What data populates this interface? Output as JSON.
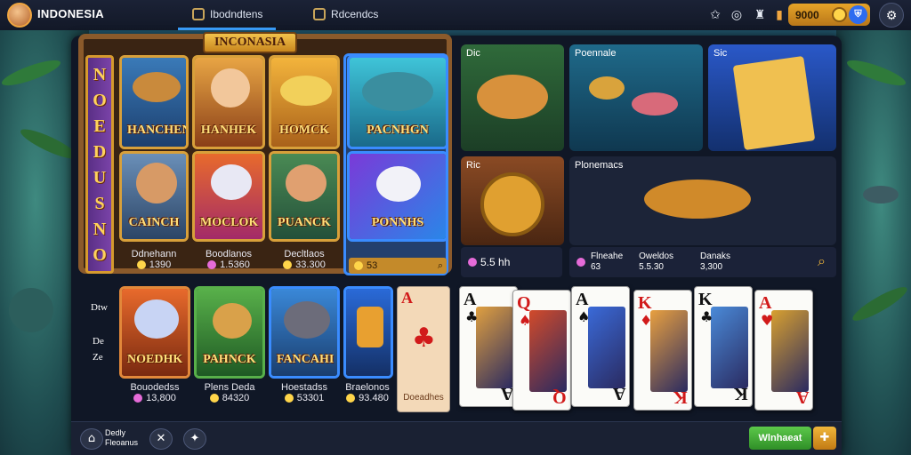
{
  "header": {
    "brand": "INDONESIA",
    "nav": [
      {
        "label": "Ibodndtens"
      },
      {
        "label": "Rdcendcs"
      }
    ],
    "balance": "9000",
    "icons": [
      "star-icon",
      "globe-icon",
      "trophy-icon",
      "coin-icon",
      "shield-icon",
      "settings-icon"
    ]
  },
  "lobby": {
    "frame_title": "INCONASIA",
    "banner_letters": [
      "N",
      "O",
      "E",
      "D",
      "U",
      "S",
      "N",
      "O"
    ],
    "tiles_top": [
      {
        "label": "HANCHEN"
      },
      {
        "label": "HANHEK"
      },
      {
        "label": "HOMCK"
      },
      {
        "label": "PACNHGN"
      }
    ],
    "tiles_mid": [
      {
        "label": "CAINCH"
      },
      {
        "label": "MOCLOK"
      },
      {
        "label": "PUANCK"
      },
      {
        "label": "PONNHS"
      }
    ],
    "meta_top": [
      {
        "name": "Ddnehann",
        "value": "1390"
      },
      {
        "name": "Boodlanos",
        "value": "1.5360"
      },
      {
        "name": "Decltlaos",
        "value": "33.300"
      },
      {
        "name": "",
        "value": "53"
      }
    ],
    "tiles_bottom": [
      {
        "label": "NOEDHK",
        "name": "Bouodedss",
        "value": "13,800"
      },
      {
        "label": "PAHNCK",
        "name": "Plens Deda",
        "value": "84320"
      },
      {
        "label": "FANCAHI",
        "name": "Hoestadss",
        "value": "53301"
      },
      {
        "label": "",
        "name": "Braelonos",
        "value": "93.480"
      }
    ],
    "side_texts": [
      "Dtw",
      "De",
      "Ze"
    ],
    "back_card_label": "Doeadhes"
  },
  "featured": {
    "cards": [
      {
        "title": "Dic"
      },
      {
        "title": "Poennale"
      },
      {
        "title": "Sic"
      },
      {
        "title": "Ric"
      },
      {
        "title": "Plonemacs"
      }
    ],
    "bar_left_value": "5.5 hh",
    "bar_right": {
      "label1": "Flneahe",
      "value1": "63",
      "label2": "Oweldos",
      "value2": "5.5.30",
      "label3": "Danaks",
      "value3": "3,300"
    }
  },
  "playing_cards": [
    {
      "rank": "A",
      "suit": "♣",
      "color": "blk"
    },
    {
      "rank": "Q",
      "suit": "♠",
      "color": "red"
    },
    {
      "rank": "A",
      "suit": "♠",
      "color": "blk"
    },
    {
      "rank": "K",
      "suit": "♦",
      "color": "red"
    },
    {
      "rank": "K",
      "suit": "♣",
      "color": "blk"
    },
    {
      "rank": "A",
      "suit": "♥",
      "color": "red"
    }
  ],
  "footer": {
    "label_line1": "Dedly",
    "label_line2": "Fleoanus",
    "play_label": "Wlnhaeat"
  }
}
